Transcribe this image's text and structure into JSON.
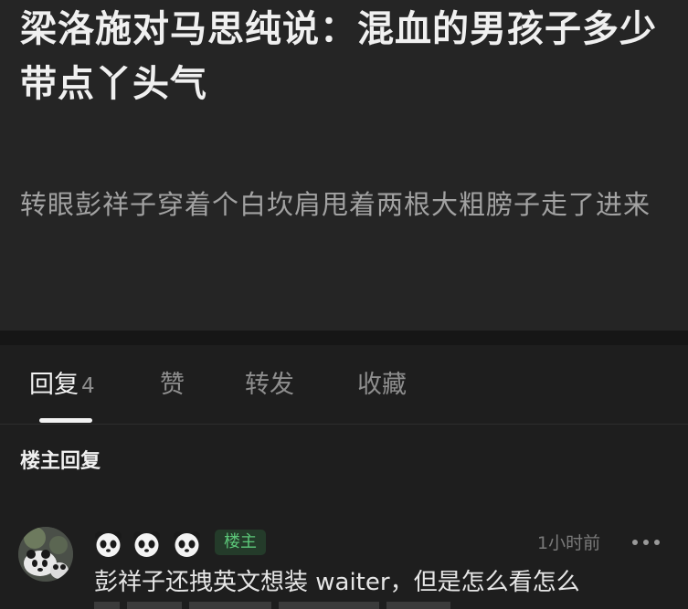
{
  "post": {
    "title": "梁洛施对马思纯说：混血的男孩子多少带点丫头气",
    "body": "转眼彭祥子穿着个白坎肩甩着两根大粗膀子走了进来"
  },
  "tabs": [
    {
      "label": "回复",
      "count": "4",
      "active": true
    },
    {
      "label": "赞"
    },
    {
      "label": "转发"
    },
    {
      "label": "收藏"
    }
  ],
  "section": {
    "title": "楼主回复"
  },
  "reply": {
    "badges": [
      "panda-icon",
      "panda-icon",
      "panda-icon"
    ],
    "owner_badge": "楼主",
    "time": "1小时前",
    "text": "彭祥子还拽英文想装 waiter，但是怎么看怎么"
  },
  "colors": {
    "background": "#1e1e1e",
    "post_background": "#252525",
    "owner_badge_text": "#5cc779",
    "owner_badge_bg": "#243b2a"
  }
}
